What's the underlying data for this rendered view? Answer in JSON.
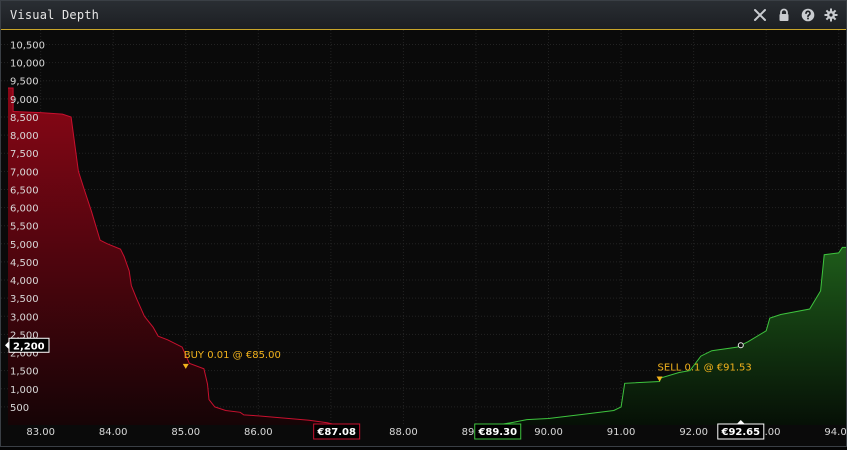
{
  "window": {
    "title": "Visual Depth",
    "icons": [
      "close-icon",
      "lock-icon",
      "help-icon",
      "gear-icon"
    ]
  },
  "chart_data": {
    "type": "area",
    "title": "",
    "xlabel": "",
    "ylabel": "",
    "xlim": [
      82.55,
      94.1
    ],
    "ylim": [
      0,
      10900
    ],
    "x_ticks": [
      "83.00",
      "84.00",
      "85.00",
      "86.00",
      "87.00",
      "88.00",
      "89.00",
      "90.00",
      "91.00",
      "92.00",
      "93.00",
      "94.00"
    ],
    "y_ticks": [
      "500",
      "1,000",
      "1,500",
      "2,000",
      "2,500",
      "3,000",
      "3,500",
      "4,000",
      "4,500",
      "5,000",
      "5,500",
      "6,000",
      "6,500",
      "7,000",
      "7,500",
      "8,000",
      "8,500",
      "9,000",
      "9,500",
      "10,000",
      "10,500"
    ],
    "grid": true,
    "series": [
      {
        "side": "bids",
        "color": "#c8102e",
        "points": [
          [
            82.55,
            9300
          ],
          [
            82.62,
            9300
          ],
          [
            82.62,
            8650
          ],
          [
            83.0,
            8620
          ],
          [
            83.3,
            8580
          ],
          [
            83.42,
            8500
          ],
          [
            83.52,
            7000
          ],
          [
            83.6,
            6500
          ],
          [
            83.7,
            5900
          ],
          [
            83.82,
            5100
          ],
          [
            83.92,
            5000
          ],
          [
            84.1,
            4850
          ],
          [
            84.15,
            4650
          ],
          [
            84.22,
            4250
          ],
          [
            84.25,
            3850
          ],
          [
            84.32,
            3500
          ],
          [
            84.43,
            3000
          ],
          [
            84.55,
            2700
          ],
          [
            84.62,
            2450
          ],
          [
            84.75,
            2350
          ],
          [
            84.95,
            2150
          ],
          [
            85.05,
            1700
          ],
          [
            85.25,
            1550
          ],
          [
            85.3,
            1130
          ],
          [
            85.32,
            700
          ],
          [
            85.4,
            500
          ],
          [
            85.55,
            400
          ],
          [
            85.75,
            350
          ],
          [
            85.8,
            280
          ],
          [
            86.0,
            250
          ],
          [
            86.3,
            200
          ],
          [
            86.7,
            130
          ],
          [
            86.95,
            60
          ],
          [
            87.08,
            0
          ]
        ]
      },
      {
        "side": "asks",
        "color": "#3ec43e",
        "points": [
          [
            89.3,
            0
          ],
          [
            89.5,
            70
          ],
          [
            89.7,
            150
          ],
          [
            90.0,
            180
          ],
          [
            90.2,
            230
          ],
          [
            90.5,
            300
          ],
          [
            90.9,
            400
          ],
          [
            91.0,
            500
          ],
          [
            91.05,
            1150
          ],
          [
            91.53,
            1200
          ],
          [
            91.55,
            1300
          ],
          [
            91.8,
            1450
          ],
          [
            91.95,
            1500
          ],
          [
            92.1,
            1900
          ],
          [
            92.25,
            2050
          ],
          [
            92.6,
            2150
          ],
          [
            92.75,
            2300
          ],
          [
            93.0,
            2600
          ],
          [
            93.05,
            2950
          ],
          [
            93.2,
            3050
          ],
          [
            93.6,
            3200
          ],
          [
            93.75,
            3700
          ],
          [
            93.8,
            4700
          ],
          [
            94.0,
            4750
          ],
          [
            94.05,
            4900
          ],
          [
            94.1,
            4900
          ]
        ]
      }
    ],
    "annotations": [
      {
        "text": "BUY 0.01 @ €85.00",
        "x": 85.0,
        "y": 1550,
        "color": "#f2b21c"
      },
      {
        "text": "SELL 0.1 @ €91.53",
        "x": 91.53,
        "y": 1200,
        "color": "#f2b21c"
      }
    ],
    "markers": {
      "best_bid": {
        "label": "€87.08",
        "x": 87.08,
        "color": "#c8102e"
      },
      "best_ask": {
        "label": "€89.30",
        "x": 89.3,
        "color": "#3ec43e"
      },
      "cursor_price": {
        "label": "€92.65",
        "x": 92.65
      },
      "cursor_volume": {
        "label": "2,200",
        "y": 2200
      }
    }
  }
}
